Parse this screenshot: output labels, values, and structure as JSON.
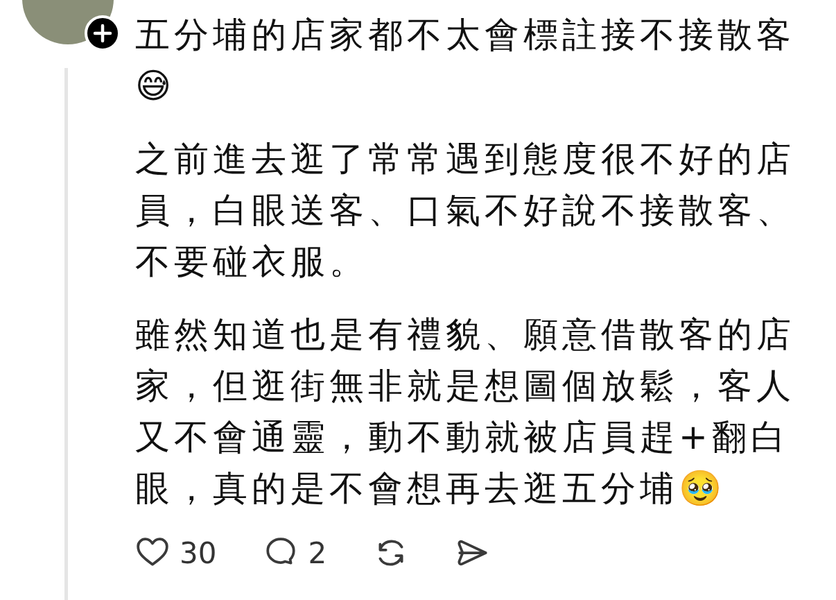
{
  "post": {
    "paragraphs": [
      "五分埔的店家都不太會標註接不接散客😅",
      "之前進去逛了常常遇到態度很不好的店員，白眼送客、口氣不好說不接散客、不要碰衣服。",
      "雖然知道也是有禮貌、願意借散客的店家，但逛街無非就是想圖個放鬆，客人又不會通靈，動不動就被店員趕+翻白眼，真的是不會想再去逛五分埔🥹"
    ],
    "actions": [
      {
        "kind": "like",
        "count": "30"
      },
      {
        "kind": "comment",
        "count": "2"
      },
      {
        "kind": "repost"
      },
      {
        "kind": "share"
      }
    ]
  }
}
